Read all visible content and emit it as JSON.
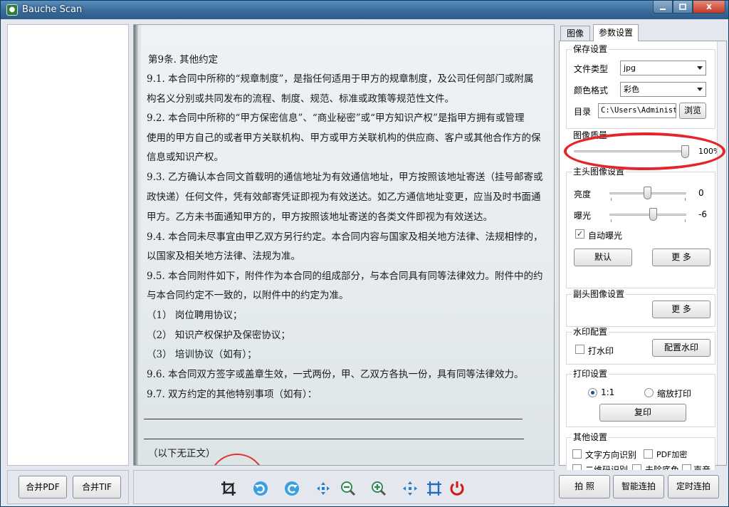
{
  "window": {
    "title": "Bauche Scan",
    "app_icon": "app-logo-icon",
    "controls": [
      "minimize-icon",
      "maximize-icon",
      "close-icon"
    ],
    "close_glyph": "x"
  },
  "document": {
    "lines": [
      "第9条.    其他约定",
      "9.1. 本合同中所称的“规章制度”，是指任何适用于甲方的规章制度，及公司任何部门或附属",
      "构名义分别或共同发布的流程、制度、规范、标准或政策等规范性文件。",
      "9.2. 本合同中所称的“甲方保密信息”、“商业秘密”或“甲方知识产权”是指甲方拥有或管理",
      "使用的甲方自己的或者甲方关联机构、甲方或甲方关联机构的供应商、客户或其他合作方的保",
      "信息或知识产权。",
      "9.3. 乙方确认本合同文首载明的通信地址为有效通信地址，甲方按照该地址寄送（挂号邮寄或",
      "政快递）任何文件，凭有效邮寄凭证即视为有效送达。如乙方通信地址变更，应当及时书面通",
      "甲方。乙方未书面通知甲方的，甲方按照该地址寄送的各类文件即视为有效送达。",
      "9.4. 本合同未尽事宜由甲乙双方另行约定。本合同内容与国家及相关地方法律、法规相悖的，",
      "以国家及相关地方法律、法规为准。",
      "9.5. 本合同附件如下，附件作为本合同的组成部分，与本合同具有同等法律效力。附件中的约",
      "与本合同约定不一致的，以附件中的约定为准。",
      "（1）    岗位聘用协议；",
      "（2）    知识产权保护及保密协议；",
      "（3）    培训协议（如有）；",
      "9.6. 本合同双方签字或盖章生效，一式两份，甲、乙双方各执一份，具有同等法律效力。",
      "9.7. 双方约定的其他特别事项（如有）：",
      "（以下无正文）"
    ]
  },
  "tabs": {
    "image": "图像",
    "params": "参数设置"
  },
  "save_settings": {
    "title": "保存设置",
    "file_type_label": "文件类型",
    "file_type_value": "jpg",
    "color_format_label": "颜色格式",
    "color_format_value": "彩色",
    "dir_label": "目录",
    "dir_value": "C:\\Users\\Administ",
    "browse_label": "浏览"
  },
  "image_quality": {
    "title": "图像质量",
    "value_text": "100%",
    "level": 1.0
  },
  "main_camera": {
    "title": "主头图像设置",
    "brightness_label": "亮度",
    "brightness_value": "0",
    "exposure_label": "曝光",
    "exposure_value": "-6",
    "auto_exposure_label": "自动曝光",
    "auto_exposure_checked": true,
    "check_glyph": "✓",
    "default_label": "默认",
    "more_label": "更 多"
  },
  "sub_camera": {
    "title": "副头图像设置",
    "more_label": "更 多"
  },
  "watermark": {
    "title": "水印配置",
    "checkbox_label": "打水印",
    "config_label": "配置水印"
  },
  "print_settings": {
    "title": "打印设置",
    "ratio_label": "1:1",
    "scale_label": "缩放打印",
    "copy_label": "复印",
    "selected": "1:1"
  },
  "other_settings": {
    "title": "其他设置",
    "text_direction": "文字方向识别",
    "pdf_encrypt": "PDF加密",
    "qr_recognize": "二维码识别",
    "remove_bg": "去除底色",
    "sound": "声音"
  },
  "bottom": {
    "merge_pdf": "合并PDF",
    "merge_tif": "合并TIF",
    "capture": "拍 照",
    "smart_batch": "智能连拍",
    "timed_batch": "定时连拍",
    "toolbar_icons": [
      "crop-icon",
      "rotate-left-icon",
      "rotate-right-icon",
      "fit-icon",
      "zoom-out-icon",
      "zoom-in-icon",
      "move-icon",
      "frame-icon",
      "power-icon"
    ]
  },
  "colors": {
    "accent": "#1f4e8c",
    "highlight": "#e3262b",
    "title_bar": "#3a6a99",
    "close": "#c43a24"
  }
}
